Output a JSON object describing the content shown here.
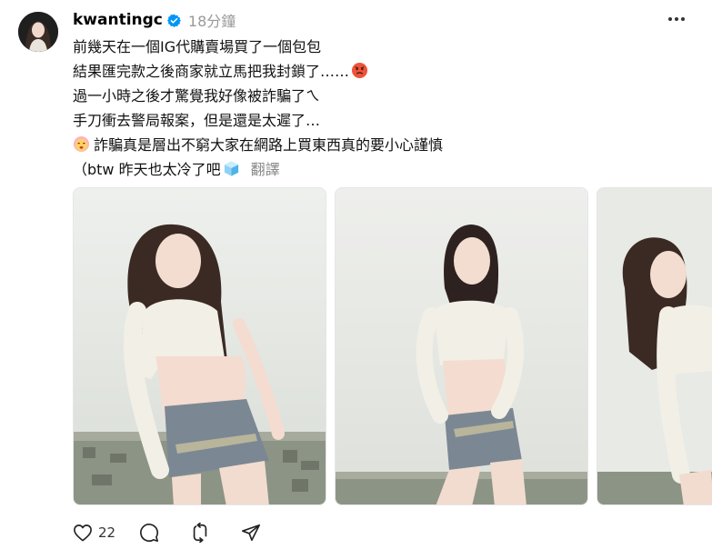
{
  "post": {
    "username": "kwantingc",
    "timestamp": "18分鐘",
    "lines": [
      "前幾天在一個IG代購賣場買了一個包包",
      "結果匯完款之後商家就立馬把我封鎖了……",
      "過一小時之後才驚覺我好像被詐騙了ㄟ",
      "手刀衝去警局報案，但是還是太遲了…",
      "詐騙真是層出不窮大家在網路上買東西真的要小心謹慎",
      "（btw 昨天也太冷了吧"
    ],
    "translate_label": "翻譯",
    "like_count": "22"
  },
  "icons": {
    "verified": "verified-badge-icon",
    "more": "more-options-icon",
    "like": "heart-icon",
    "comment": "comment-icon",
    "repost": "repost-icon",
    "share": "send-icon",
    "emoji_line2": "pouting-emoji-icon",
    "emoji_line5": "cold-face-emoji-icon",
    "emoji_line6": "ice-cube-emoji-icon"
  },
  "colors": {
    "verified_blue": "#0095f6",
    "secondary_text": "#999999",
    "translate_text": "#888888"
  }
}
